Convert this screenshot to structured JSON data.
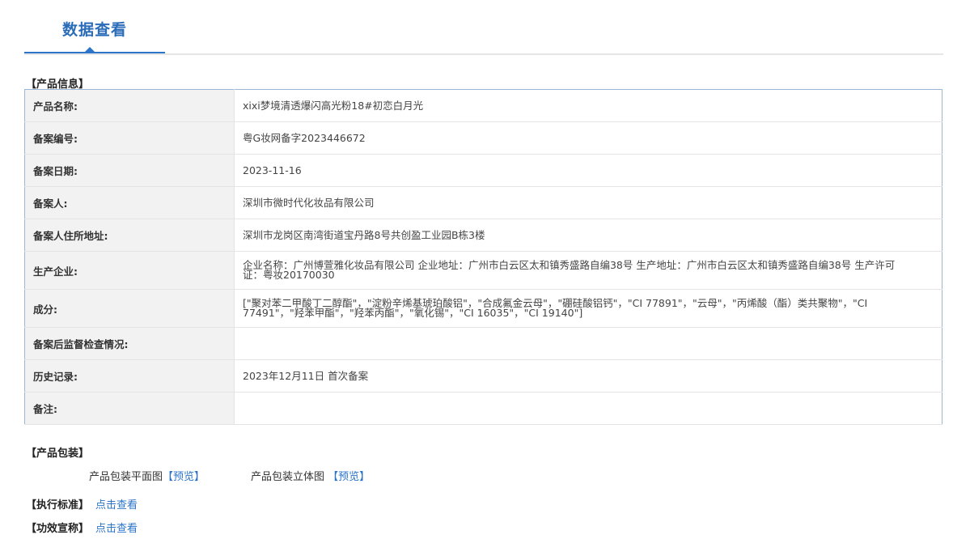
{
  "header": {
    "tab_title": "数据查看"
  },
  "product_info": {
    "section_title": "【产品信息】",
    "rows": [
      {
        "label": "产品名称:",
        "value": "xixi梦境清透爆闪高光粉18#初恋白月光"
      },
      {
        "label": "备案编号:",
        "value": "粤G妆网备字2023446672"
      },
      {
        "label": "备案日期:",
        "value": "2023-11-16"
      },
      {
        "label": "备案人:",
        "value": "深圳市微时代化妆品有限公司"
      },
      {
        "label": "备案人住所地址:",
        "value": "深圳市龙岗区南湾街道宝丹路8号共创盈工业园B栋3楼"
      },
      {
        "label": "生产企业:",
        "value": "企业名称：广州博萱雅化妆品有限公司 企业地址：广州市白云区太和镇秀盛路自编38号 生产地址：广州市白云区太和镇秀盛路自编38号 生产许可证：粤妆20170030"
      },
      {
        "label": "成分:",
        "value": "[\"聚对苯二甲酸丁二醇酯\"，\"淀粉辛烯基琥珀酸铝\"，\"合成氟金云母\"，\"硼硅酸铝钙\"，\"CI 77891\"，\"云母\"，\"丙烯酸（酯）类共聚物\"，\"CI 77491\"，\"羟苯甲酯\"，\"羟苯丙酯\"，\"氧化锡\"，\"CI 16035\"，\"CI 19140\"]"
      },
      {
        "label": "备案后监督检查情况:",
        "value": ""
      },
      {
        "label": "历史记录:",
        "value": "2023年12月11日 首次备案"
      },
      {
        "label": "备注:",
        "value": ""
      }
    ]
  },
  "packaging": {
    "section_title": "【产品包装】",
    "flat_label": "产品包装平面图",
    "flat_link": "【预览】",
    "stereo_label": "产品包装立体图",
    "stereo_link": "【预览】"
  },
  "standard": {
    "label": "【执行标准】",
    "link": "点击查看"
  },
  "efficacy": {
    "label": "【功效宣称】",
    "link": "点击查看"
  },
  "colors": {
    "accent": "#2b74c7",
    "label_bg": "#f2f2f2",
    "table_border": "#9db6d6"
  }
}
